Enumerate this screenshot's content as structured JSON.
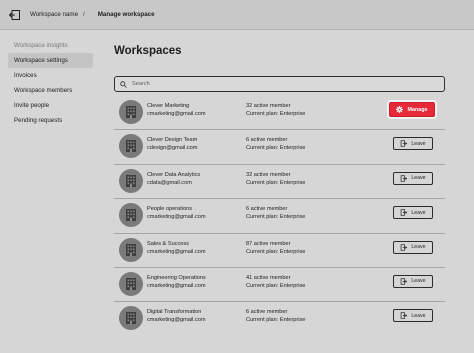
{
  "breadcrumb": {
    "workspace_name": "Workspace name",
    "current": "Manage workspace"
  },
  "sidebar": {
    "items": [
      {
        "label": "Workspace insights"
      },
      {
        "label": "Workspace settings"
      },
      {
        "label": "Invoices"
      },
      {
        "label": "Workspace members"
      },
      {
        "label": "Invite people"
      },
      {
        "label": "Pending requests"
      }
    ]
  },
  "main": {
    "title": "Workspaces",
    "search_placeholder": "Search"
  },
  "workspaces": [
    {
      "name": "Clever Marketing",
      "email": "cmarketing@gmail.com",
      "members": "32 active member",
      "plan": "Current plan: Enterprise",
      "action": "Manage"
    },
    {
      "name": "Clever Design Team",
      "email": "cdesign@gmail.com",
      "members": "6 active member",
      "plan": "Current plan: Enterprise",
      "action": "Leave"
    },
    {
      "name": "Clever Data Analytics",
      "email": "cdata@gmail.com",
      "members": "32 active member",
      "plan": "Current plan: Enterprise",
      "action": "Leave"
    },
    {
      "name": "People operations",
      "email": "cmarketing@gmail.com",
      "members": "6 active member",
      "plan": "Current plan: Enterprise",
      "action": "Leave"
    },
    {
      "name": "Sales & Success",
      "email": "cmarketing@gmail.com",
      "members": "87 active member",
      "plan": "Current plan: Enterprise",
      "action": "Leave"
    },
    {
      "name": "Engineering Operations",
      "email": "cmarketing@gmail.com",
      "members": "41 active member",
      "plan": "Current plan: Enterprise",
      "action": "Leave"
    },
    {
      "name": "Digital Transformation",
      "email": "cmarketing@gmail.com",
      "members": "6 active member",
      "plan": "Current plan: Enterprise",
      "action": "Leave"
    }
  ],
  "icons": {
    "back": "exit-back-icon",
    "search": "search-icon",
    "avatar": "building-icon",
    "manage": "gear-icon",
    "leave": "door-exit-icon"
  },
  "colors": {
    "accent": "#e8293a",
    "background": "#d6d6d6"
  }
}
